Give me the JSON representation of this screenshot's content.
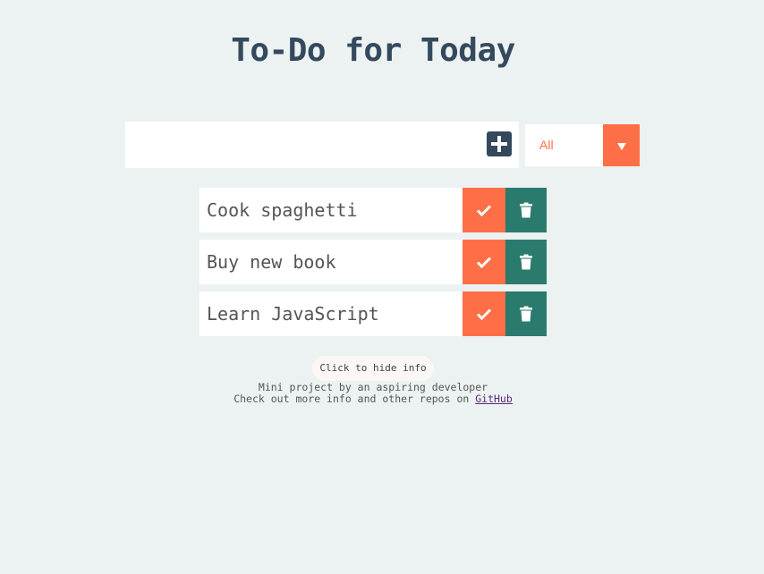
{
  "header": {
    "title": "To-Do for Today"
  },
  "add_form": {
    "input_value": "",
    "input_placeholder": "",
    "add_icon": "plus-square-icon"
  },
  "filter": {
    "selected": "All",
    "arrow_icon": "caret-down-icon"
  },
  "todos": [
    {
      "text": "Cook spaghetti"
    },
    {
      "text": "Buy new book"
    },
    {
      "text": "Learn JavaScript"
    }
  ],
  "info": {
    "toggle_label": "Click to hide info",
    "line1": "Mini project by an aspiring developer",
    "line2_prefix": "Check out more info and other repos on ",
    "link_label": "GitHub"
  },
  "colors": {
    "background": "#ebf2f1",
    "title": "#34495e",
    "accent_orange": "#ff6f47",
    "accent_green": "#2b7a6e",
    "link": "#5b2a7a"
  }
}
